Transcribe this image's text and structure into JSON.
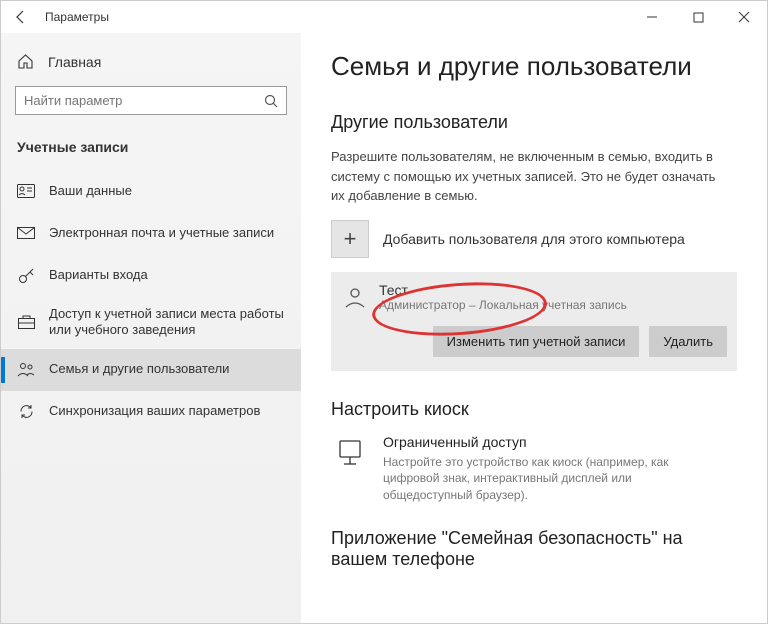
{
  "window": {
    "title": "Параметры"
  },
  "sidebar": {
    "home": "Главная",
    "search_placeholder": "Найти параметр",
    "section": "Учетные записи",
    "items": [
      {
        "label": "Ваши данные"
      },
      {
        "label": "Электронная почта и учетные записи"
      },
      {
        "label": "Варианты входа"
      },
      {
        "label": "Доступ к учетной записи места работы или учебного заведения"
      },
      {
        "label": "Семья и другие пользователи"
      },
      {
        "label": "Синхронизация ваших параметров"
      }
    ]
  },
  "main": {
    "title": "Семья и другие пользователи",
    "other_users_heading": "Другие пользователи",
    "other_users_desc": "Разрешите пользователям, не включенным в семью, входить в систему с помощью их учетных записей. Это не будет означать их добавление в семью.",
    "add_user": "Добавить пользователя для этого компьютера",
    "user": {
      "name": "Тест",
      "role": "Администратор – Локальная учетная запись"
    },
    "change_type_btn": "Изменить тип учетной записи",
    "delete_btn": "Удалить",
    "kiosk_heading": "Настроить киоск",
    "kiosk_title": "Ограниченный доступ",
    "kiosk_desc": "Настройте это устройство как киоск (например, как цифровой знак, интерактивный дисплей или общедоступный браузер).",
    "app_heading": "Приложение \"Семейная безопасность\" на вашем телефоне"
  }
}
